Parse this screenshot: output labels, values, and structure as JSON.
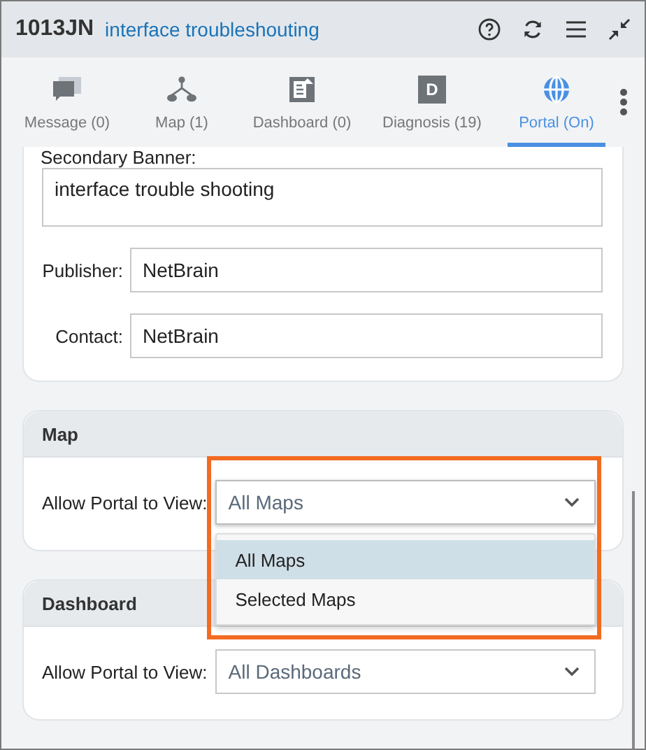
{
  "header": {
    "title": "1013JN",
    "subtitle": "interface troubleshouting"
  },
  "tabs": [
    {
      "kind": "message",
      "label": "Message (0)",
      "selected": false
    },
    {
      "kind": "map",
      "label": "Map (1)",
      "selected": false
    },
    {
      "kind": "dashboard",
      "label": "Dashboard (0)",
      "selected": false
    },
    {
      "kind": "diagnosis",
      "label": "Diagnosis (19)",
      "icon_letter": "D",
      "selected": false
    },
    {
      "kind": "portal",
      "label": "Portal (On)",
      "selected": true
    }
  ],
  "banner_card": {
    "label": "Secondary Banner:",
    "value": "interface trouble shooting",
    "fields": [
      {
        "label": "Publisher:",
        "value": "NetBrain"
      },
      {
        "label": "Contact:",
        "value": "NetBrain"
      }
    ]
  },
  "sections": [
    {
      "title": "Map",
      "label": "Allow Portal to View:",
      "value": "All Maps",
      "expanded": true,
      "highlighted": true,
      "options": [
        {
          "label": "All Maps",
          "selected": true
        },
        {
          "label": "Selected Maps",
          "selected": false
        }
      ]
    },
    {
      "title": "Dashboard",
      "label": "Allow Portal to View:",
      "value": "All Dashboards",
      "expanded": false,
      "highlighted": false
    }
  ]
}
